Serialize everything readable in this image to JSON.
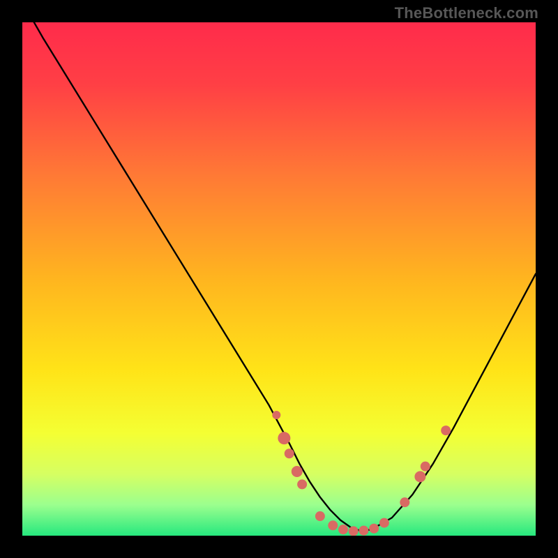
{
  "watermark": "TheBottleneck.com",
  "colors": {
    "dot_fill": "#d96a63",
    "curve_stroke": "#000000",
    "gradient_stops": [
      {
        "offset": "0%",
        "color": "#ff2b4b"
      },
      {
        "offset": "12%",
        "color": "#ff3f45"
      },
      {
        "offset": "30%",
        "color": "#ff7a35"
      },
      {
        "offset": "50%",
        "color": "#ffb51f"
      },
      {
        "offset": "68%",
        "color": "#ffe418"
      },
      {
        "offset": "80%",
        "color": "#f4ff33"
      },
      {
        "offset": "88%",
        "color": "#d6ff62"
      },
      {
        "offset": "94%",
        "color": "#9bff8e"
      },
      {
        "offset": "100%",
        "color": "#26e87e"
      }
    ]
  },
  "chart_data": {
    "type": "line",
    "title": "",
    "xlabel": "",
    "ylabel": "",
    "xlim": [
      0,
      100
    ],
    "ylim": [
      0,
      100
    ],
    "series": [
      {
        "name": "bottleneck-curve",
        "x": [
          0,
          4,
          8,
          12,
          16,
          20,
          24,
          28,
          32,
          36,
          40,
          44,
          48,
          52,
          54,
          56,
          58,
          60,
          62,
          64,
          66,
          68,
          72,
          76,
          80,
          84,
          88,
          92,
          96,
          100
        ],
        "y": [
          104,
          97,
          90.5,
          84,
          77.5,
          71,
          64.5,
          58,
          51.5,
          45,
          38.5,
          32,
          25.5,
          18,
          14,
          10.5,
          7.5,
          5,
          3,
          1.6,
          0.9,
          1.2,
          3.5,
          8,
          14,
          21,
          28.5,
          36,
          43.5,
          51
        ]
      }
    ],
    "dots": [
      {
        "x": 49.5,
        "y": 23.5,
        "r": 6
      },
      {
        "x": 51.0,
        "y": 19.0,
        "r": 9
      },
      {
        "x": 52.0,
        "y": 16.0,
        "r": 7
      },
      {
        "x": 53.5,
        "y": 12.5,
        "r": 8
      },
      {
        "x": 54.5,
        "y": 10.0,
        "r": 7
      },
      {
        "x": 58.0,
        "y": 3.8,
        "r": 7
      },
      {
        "x": 60.5,
        "y": 2.0,
        "r": 7
      },
      {
        "x": 62.5,
        "y": 1.2,
        "r": 7
      },
      {
        "x": 64.5,
        "y": 0.9,
        "r": 7
      },
      {
        "x": 66.5,
        "y": 1.0,
        "r": 7
      },
      {
        "x": 68.5,
        "y": 1.4,
        "r": 7
      },
      {
        "x": 70.5,
        "y": 2.5,
        "r": 7
      },
      {
        "x": 74.5,
        "y": 6.5,
        "r": 7
      },
      {
        "x": 77.5,
        "y": 11.5,
        "r": 8
      },
      {
        "x": 78.5,
        "y": 13.5,
        "r": 7
      },
      {
        "x": 82.5,
        "y": 20.5,
        "r": 7
      }
    ]
  }
}
